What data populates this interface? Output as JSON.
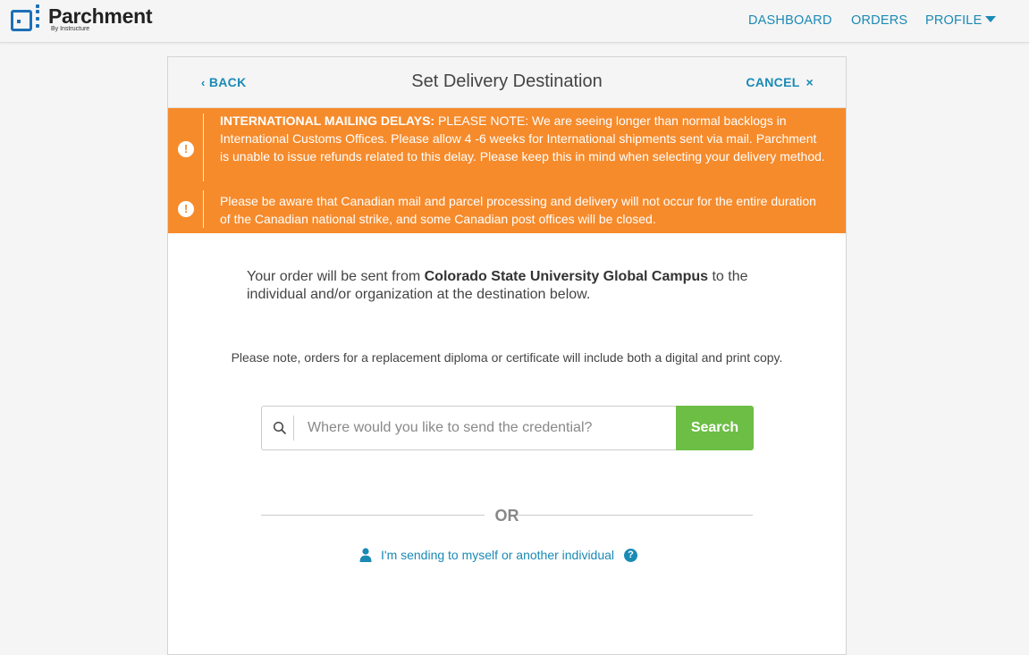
{
  "brand": {
    "name": "Parchment",
    "tagline": "By Instructure",
    "color": "#1d6fb8"
  },
  "nav": {
    "dashboard": "DASHBOARD",
    "orders": "ORDERS",
    "profile": "PROFILE"
  },
  "header": {
    "back": "BACK",
    "title": "Set Delivery Destination",
    "cancel": "CANCEL"
  },
  "alerts": [
    {
      "bold": "INTERNATIONAL MAILING DELAYS:",
      "text": " PLEASE NOTE: We are seeing longer than normal backlogs in International Customs Offices. Please allow 4 -6 weeks for International shipments sent via mail. Parchment is unable to issue refunds related to this delay. Please keep this in mind when selecting your delivery method."
    },
    {
      "bold": "",
      "text": "Please be aware that Canadian mail and parcel processing and delivery will not occur for the entire duration of the Canadian national strike, and some Canadian post offices will be closed."
    }
  ],
  "intro": {
    "before": "Your order will be sent from ",
    "institution": "Colorado State University Global Campus",
    "after": " to the individual and/or organization at the destination below."
  },
  "note": "Please note, orders for a replacement diploma or certificate will include both a digital and print copy.",
  "search": {
    "placeholder": "Where would you like to send the credential?",
    "value": "",
    "button": "Search"
  },
  "or_label": "OR",
  "self_link": "I'm sending to myself or another individual",
  "colors": {
    "accent": "#1a8ab5",
    "alert": "#f68b2c",
    "search_button": "#6cbe45"
  }
}
